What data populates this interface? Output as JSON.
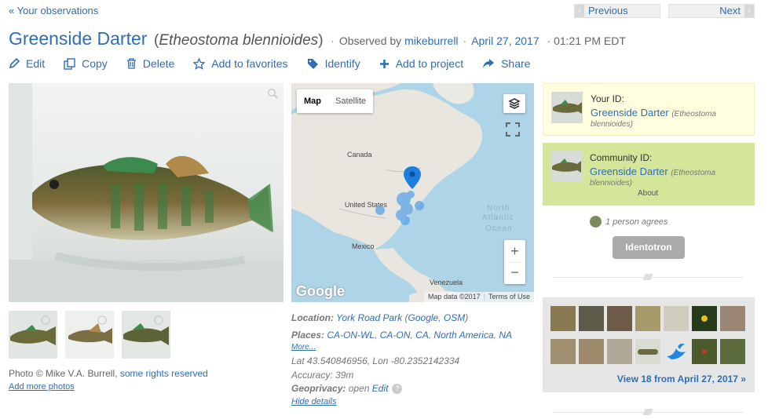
{
  "nav": {
    "back": "« Your observations",
    "previous": "Previous",
    "next": "Next"
  },
  "observation": {
    "common_name": "Greenside Darter",
    "scientific_name": "Etheostoma blennioides",
    "observed_by_label": "Observed by",
    "observer": "mikeburrell",
    "date": "April 27, 2017",
    "time": "· 01:21 PM EDT"
  },
  "actions": [
    {
      "label": "Edit",
      "icon": "pencil-icon"
    },
    {
      "label": "Copy",
      "icon": "copy-icon"
    },
    {
      "label": "Delete",
      "icon": "trash-icon"
    },
    {
      "label": "Add to favorites",
      "icon": "star-icon"
    },
    {
      "label": "Identify",
      "icon": "tag-icon"
    },
    {
      "label": "Add to project",
      "icon": "plus-icon"
    },
    {
      "label": "Share",
      "icon": "share-icon"
    }
  ],
  "photos": {
    "credit_prefix": "Photo © Mike V.A. Burrell,",
    "credit_link": "some rights reserved",
    "add_more": "Add more photos"
  },
  "map": {
    "tab_map": "Map",
    "tab_satellite": "Satellite",
    "labels": {
      "canada": "Canada",
      "united_states": "United States",
      "mexico": "Mexico",
      "venezuela": "Venezuela",
      "ocean": "North\nAtlantic\nOcean"
    },
    "zoom_in": "+",
    "zoom_out": "−",
    "google": "Google",
    "attribution": "Map data ©2017",
    "terms": "Terms of Use"
  },
  "details": {
    "location_label": "Location:",
    "location_value": "York Road Park",
    "location_links": [
      "Google",
      "OSM"
    ],
    "places_label": "Places:",
    "places": [
      "CA-ON-WL",
      "CA-ON",
      "CA",
      "North America",
      "NA"
    ],
    "more": "More...",
    "latlon": "Lat 43.540846956, Lon -80.2352142334",
    "accuracy": "Accuracy: 39m",
    "geoprivacy_label": "Geoprivacy:",
    "geoprivacy_value": "open",
    "geoprivacy_edit": "Edit",
    "hide": "Hide details"
  },
  "your_id": {
    "label": "Your ID:",
    "name": "Greenside Darter",
    "sci_a": "(Etheostoma",
    "sci_b": "blennioides)"
  },
  "community_id": {
    "label": "Community ID:",
    "name": "Greenside Darter",
    "sci_a": "(Etheostoma",
    "sci_b": "blennioides)",
    "about": "About"
  },
  "agrees": "1 person agrees",
  "identotron": "Identotron",
  "gallery": {
    "view_more": "View 18 from April 27, 2017 »"
  },
  "colors": {
    "link": "#2f6db5",
    "your_id_bg": "#ffffe0",
    "community_bg": "#d5e59a"
  }
}
